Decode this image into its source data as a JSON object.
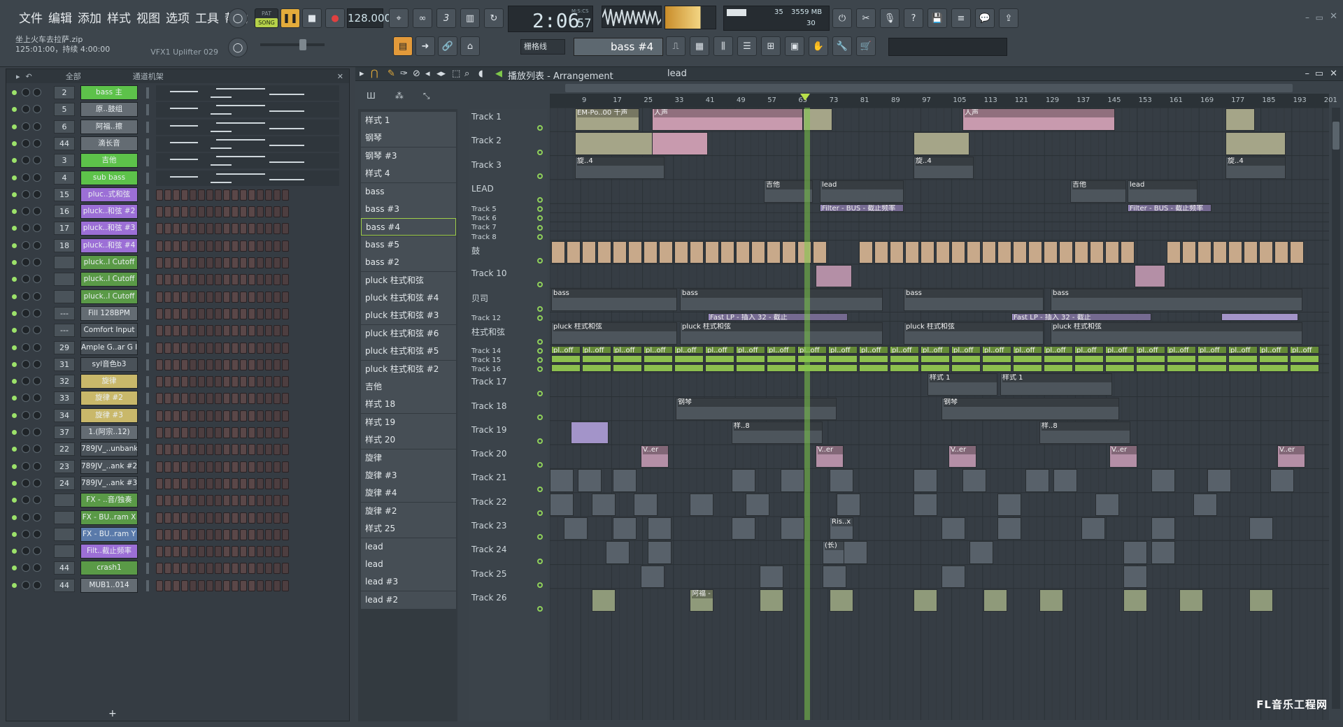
{
  "menu": [
    "文件",
    "编辑",
    "添加",
    "样式",
    "视图",
    "选项",
    "工具",
    "帮助"
  ],
  "transport": {
    "mode_pat": "PAT",
    "mode_song": "SONG",
    "tempo": "128.000",
    "time": "2:06",
    "time_sub": "57",
    "time_label": "M:S:CS",
    "cpu": "35",
    "mem": "3559 MB",
    "poly": "30"
  },
  "song": {
    "filename": "坐上火车去拉萨.zip",
    "info": "125:01:00，持续 4:00:00",
    "plugin": "VFX1 Uplifter 029"
  },
  "snap": "栅格线",
  "pattern_selector": "bass #4",
  "channel_rack": {
    "filter": "全部",
    "title": "通道机架",
    "add": "+",
    "channels": [
      {
        "num": "2",
        "name": "bass 主",
        "color": "#5dc24a"
      },
      {
        "num": "5",
        "name": "原..鼓组",
        "color": "#646c73"
      },
      {
        "num": "6",
        "name": "阿福..擦",
        "color": "#646c73"
      },
      {
        "num": "44",
        "name": "滴长音",
        "color": "#646c73"
      },
      {
        "num": "3",
        "name": "吉他",
        "color": "#5dc24a"
      },
      {
        "num": "4",
        "name": "sub bass",
        "color": "#5dc24a"
      },
      {
        "num": "15",
        "name": "pluc..式和弦",
        "color": "#9c6fd6"
      },
      {
        "num": "16",
        "name": "pluck..和弦 #2",
        "color": "#9c6fd6"
      },
      {
        "num": "17",
        "name": "pluck..和弦 #3",
        "color": "#9c6fd6"
      },
      {
        "num": "18",
        "name": "pluck..和弦 #4",
        "color": "#9c6fd6"
      },
      {
        "num": "",
        "name": "pluck..l Cutoff",
        "color": "#5a9a47"
      },
      {
        "num": "",
        "name": "pluck..l Cutoff",
        "color": "#5a9a47"
      },
      {
        "num": "",
        "name": "pluck..l Cutoff",
        "color": "#5a9a47"
      },
      {
        "num": "---",
        "name": "Fill 128BPM",
        "color": "#646c73"
      },
      {
        "num": "---",
        "name": "Comfort Input",
        "color": "#4a5259"
      },
      {
        "num": "29",
        "name": "Ample G..ar G II",
        "color": "#4a5259"
      },
      {
        "num": "31",
        "name": "syl音色b3",
        "color": "#4a5259"
      },
      {
        "num": "32",
        "name": "旋律",
        "color": "#c9b86a"
      },
      {
        "num": "33",
        "name": "旋律 #2",
        "color": "#c9b86a"
      },
      {
        "num": "34",
        "name": "旋律 #3",
        "color": "#c9b86a"
      },
      {
        "num": "37",
        "name": "1.(阿宗..12)",
        "color": "#646c73"
      },
      {
        "num": "22",
        "name": "789JV_..unbank",
        "color": "#4a5259"
      },
      {
        "num": "23",
        "name": "789JV_..ank #2",
        "color": "#4a5259"
      },
      {
        "num": "24",
        "name": "789JV_..ank #3",
        "color": "#4a5259"
      },
      {
        "num": "",
        "name": "FX - ..音/独奏",
        "color": "#5a9a47"
      },
      {
        "num": "",
        "name": "FX - BU..ram X",
        "color": "#5a9a47"
      },
      {
        "num": "",
        "name": "FX - BU..ram Y",
        "color": "#5a7aaa"
      },
      {
        "num": "",
        "name": "Filt..截止频率",
        "color": "#9c6fd6"
      },
      {
        "num": "44",
        "name": "crash1",
        "color": "#5a9a47"
      },
      {
        "num": "44",
        "name": "MUB1..014",
        "color": "#646c73"
      }
    ]
  },
  "playlist": {
    "title": "播放列表 - Arrangement",
    "crumb": "lead",
    "patterns": [
      "样式 1",
      "钢琴",
      "钢琴 #3",
      "样式 4",
      "bass",
      "bass #3",
      "bass #4",
      "bass #5",
      "bass #2",
      "pluck 柱式和弦",
      "pluck 柱式和弦 #4",
      "pluck 柱式和弦 #3",
      "pluck 柱式和弦 #6",
      "pluck 柱式和弦 #5",
      "pluck 柱式和弦 #2",
      "吉他",
      "样式 18",
      "样式 19",
      "样式 20",
      "旋律",
      "旋律 #3",
      "旋律 #4",
      "旋律 #2",
      "样式 25",
      "lead",
      "lead",
      "lead #3",
      "lead #2"
    ],
    "ruler": [
      "9",
      "17",
      "25",
      "33",
      "41",
      "49",
      "57",
      "65",
      "73",
      "81",
      "89",
      "97",
      "105",
      "113",
      "121",
      "129",
      "137",
      "145",
      "153",
      "161",
      "169",
      "177",
      "185",
      "193",
      "201"
    ],
    "tracks": [
      {
        "label": "Track 1",
        "small": false
      },
      {
        "label": "Track 2",
        "small": false
      },
      {
        "label": "Track 3",
        "small": false
      },
      {
        "label": "LEAD",
        "small": false
      },
      {
        "label": "Track 5",
        "small": true
      },
      {
        "label": "Track 6",
        "small": true
      },
      {
        "label": "Track 7",
        "small": true
      },
      {
        "label": "Track 8",
        "small": true
      },
      {
        "label": "鼓",
        "small": false
      },
      {
        "label": "Track 10",
        "small": false
      },
      {
        "label": "贝司",
        "small": false
      },
      {
        "label": "Track 12",
        "small": true
      },
      {
        "label": "柱式和弦",
        "small": false
      },
      {
        "label": "Track 14",
        "small": true
      },
      {
        "label": "Track 15",
        "small": true
      },
      {
        "label": "Track 16",
        "small": true
      },
      {
        "label": "Track 17",
        "small": false
      },
      {
        "label": "Track 18",
        "small": false
      },
      {
        "label": "Track 19",
        "small": false
      },
      {
        "label": "Track 20",
        "small": false
      },
      {
        "label": "Track 21",
        "small": false
      },
      {
        "label": "Track 22",
        "small": false
      },
      {
        "label": "Track 23",
        "small": false
      },
      {
        "label": "Track 24",
        "small": false
      },
      {
        "label": "Track 25",
        "small": false
      },
      {
        "label": "Track 26",
        "small": false
      }
    ],
    "clip_labels": {
      "t1": "EM-Po..00 千声",
      "t1b": "人声",
      "lead": "lead",
      "guitar": "吉他",
      "filter": "Filter - BUS - 截止频率",
      "bass": "bass",
      "pluck": "pluck 柱式和弦",
      "fastlp": "Fast LP - 插入 32 - 截止",
      "pl": "pl..off",
      "piano": "钢琴",
      "style1": "样式 1",
      "style8": "样..8",
      "ver": "V..er",
      "ris": "Ris..x",
      "long": "(长)",
      "afu": "阿福 - 擦擦",
      "rotate": "旋..4"
    }
  },
  "watermark": "FL音乐工程网",
  "colors": {
    "accent": "#e3ab3b",
    "green": "#5dc24a",
    "purple": "#9c6fd6",
    "clip_pink": "#c89aae",
    "clip_olive": "#a5a588",
    "clip_green": "#8cbf4e",
    "playhead": "#7ec84a"
  }
}
